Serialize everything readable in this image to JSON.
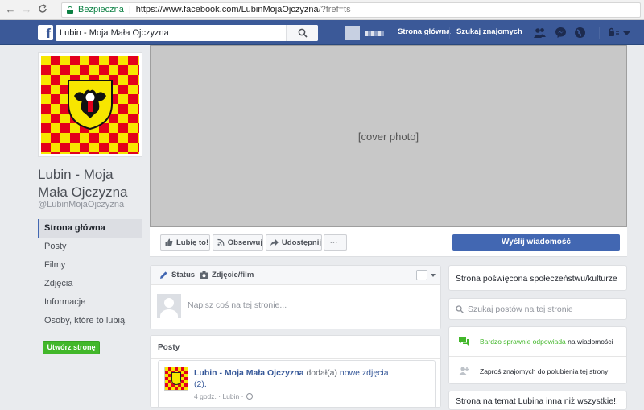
{
  "browser": {
    "back": "←",
    "forward": "→",
    "reload": "C",
    "secure_label": "Bezpieczna",
    "url_main": "https://www.facebook.com/LubinMojaOjczyzna",
    "url_rest": "/?fref=ts"
  },
  "topbar": {
    "logo": "f",
    "search_value": "Lubin - Moja Mała Ojczyzna",
    "home_label": "Strona główna",
    "find_friends_label": "Szukaj znajomych"
  },
  "page": {
    "name": "Lubin - Moja Mała Ojczyzna",
    "handle": "@LubinMojaOjczyzna",
    "cover_caption": "[cover photo]"
  },
  "leftnav": {
    "items": [
      "Strona główna",
      "Posty",
      "Filmy",
      "Zdjęcia",
      "Informacje",
      "Osoby, które to lubią"
    ],
    "create_page_label": "Utwórz stronę"
  },
  "actions": {
    "like_label": "Lubię to!",
    "follow_label": "Obserwuj",
    "share_label": "Udostępnij",
    "more_label": "···",
    "message_label": "Wyślij wiadomość"
  },
  "composer": {
    "status_tab": "Status",
    "photo_tab": "Zdjęcie/film",
    "placeholder": "Napisz coś na tej stronie..."
  },
  "posts": {
    "title": "Posty",
    "first": {
      "author": "Lubin - Moja Mała Ojczyzna",
      "action": "dodał(a)",
      "object": "nowe zdjęcia",
      "count": "(2).",
      "time": "4 godz.",
      "place": "Lubin"
    }
  },
  "sidebar": {
    "about": "Strona poświęcona społeczeństwu/kulturze",
    "search_placeholder": "Szukaj postów na tej stronie",
    "responsiveness_strong": "Bardzo sprawnie odpowiada",
    "responsiveness_rest": " na wiadomości",
    "invite": "Zaproś znajomych do polubienia tej strony",
    "bottom_text": "Strona na temat Lubina inna niż wszystkie!!"
  },
  "colors": {
    "fb_blue": "#3b5998",
    "button_blue": "#4267b2",
    "create_green": "#42b72a",
    "coat_red": "#e3001b",
    "coat_yellow": "#f7e600"
  }
}
